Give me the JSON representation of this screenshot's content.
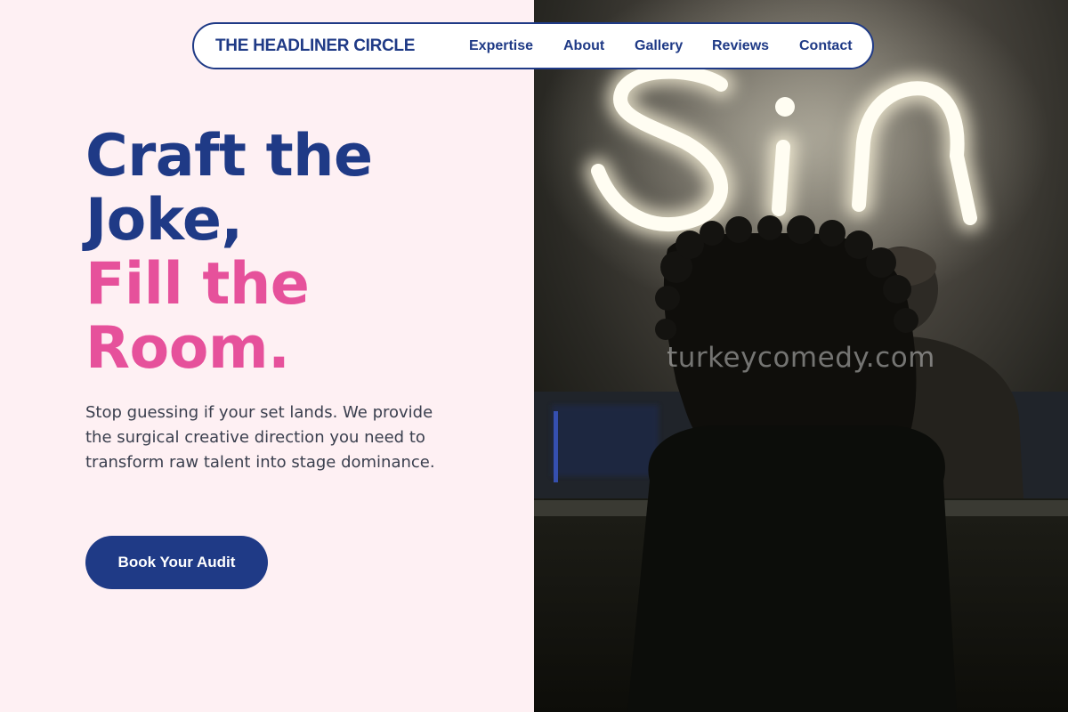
{
  "nav": {
    "brand": "THE HEADLINER CIRCLE",
    "links": [
      "Expertise",
      "About",
      "Gallery",
      "Reviews",
      "Contact"
    ]
  },
  "hero": {
    "headline_line1": "Craft the",
    "headline_line2": "Joke,",
    "headline_line3": "Fill the",
    "headline_line4": "Room.",
    "lead": "Stop guessing if your set lands. We provide the surgical creative direction you need to transform raw talent into stage dominance.",
    "cta_label": "Book Your Audit"
  },
  "photo": {
    "neon_sign_text": "Sin",
    "watermark": "turkeycomedy.com"
  },
  "colors": {
    "navy": "#1f3a86",
    "pink": "#e6519b",
    "background": "#fef0f3",
    "body_text": "#3a3f4e"
  }
}
